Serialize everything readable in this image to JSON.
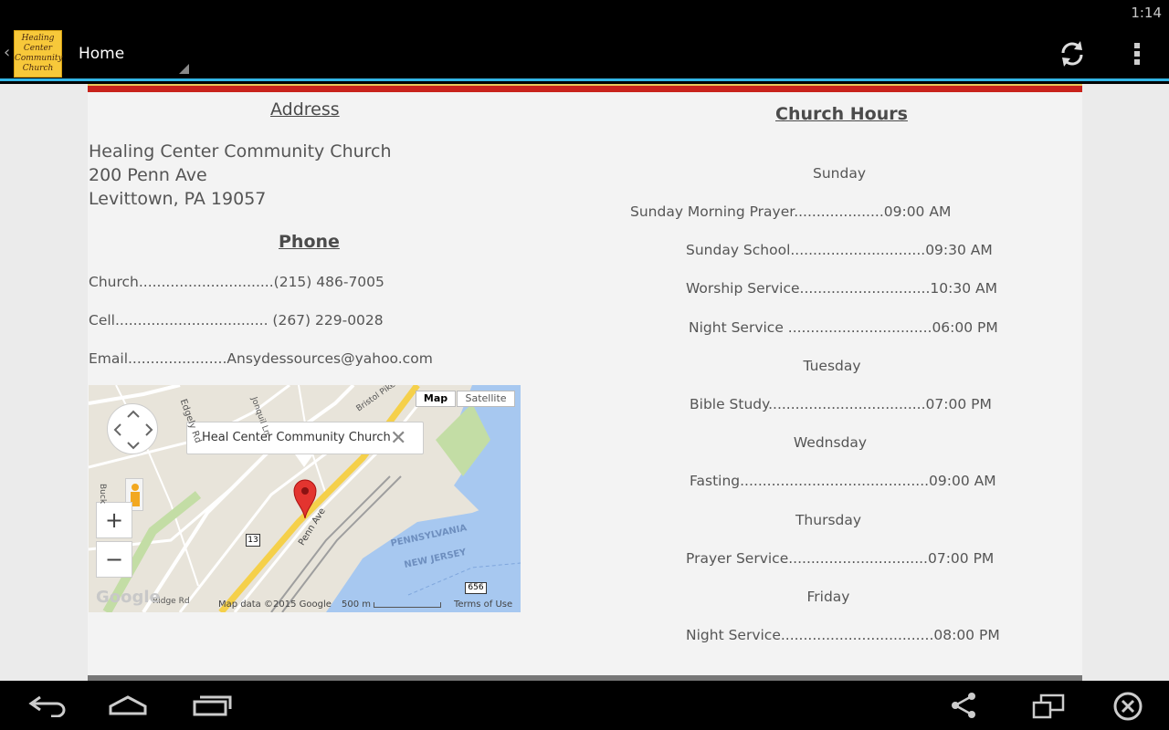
{
  "status_bar": {
    "time": "1:14"
  },
  "action_bar": {
    "logo_text": [
      "Healing",
      "Center",
      "Community",
      "Church"
    ],
    "title": "Home",
    "icons": [
      "back-caret-icon",
      "refresh-icon",
      "overflow-menu-icon"
    ]
  },
  "address": {
    "heading": "Address",
    "lines": [
      "Healing Center Community Church",
      "200 Penn Ave",
      "Levittown, PA 19057"
    ]
  },
  "phone": {
    "heading": "Phone",
    "church": "Church..............................(215) 486-7005",
    "cell": "Cell.................................. (267) 229-0028",
    "email": "Email......................Ansydessources@yahoo.com"
  },
  "map": {
    "type_buttons": [
      "Map",
      "Satellite"
    ],
    "callout": "Heal Center Community Church",
    "street_labels": [
      "Edgely Rd",
      "Penn Ave",
      "Jonquil Ln",
      "Bristol Pike",
      "Ridge Rd",
      "Buck"
    ],
    "state_labels": [
      "PENNSYLVANIA",
      "NEW JERSEY"
    ],
    "route_shields": [
      "13",
      "656"
    ],
    "zoom_in": "+",
    "zoom_out": "−",
    "google_logo": "Google",
    "attribution": "Map data ©2015 Google",
    "scale": "500 m",
    "terms": "Terms of Use"
  },
  "hours": {
    "heading": "Church Hours",
    "sunday_label": "Sunday",
    "sunday": [
      "Sunday Morning Prayer....................09:00 AM",
      "Sunday School..............................09:30 AM",
      "Worship Service.............................10:30 AM",
      "Night Service ................................06:00 PM"
    ],
    "tuesday_label": "Tuesday",
    "tuesday": [
      "Bible Study...................................07:00 PM"
    ],
    "wednesday_label": "Wednsday",
    "wednesday": [
      "Fasting..........................................09:00 AM"
    ],
    "thursday_label": "Thursday",
    "thursday": [
      "Prayer Service...............................07:00 PM"
    ],
    "friday_label": "Friday",
    "friday": [
      "Night Service..................................08:00 PM"
    ]
  },
  "nav_bar": {
    "icons": [
      "back-icon",
      "home-icon",
      "recent-apps-icon",
      "share-icon",
      "window-icon",
      "close-circle-icon"
    ]
  }
}
